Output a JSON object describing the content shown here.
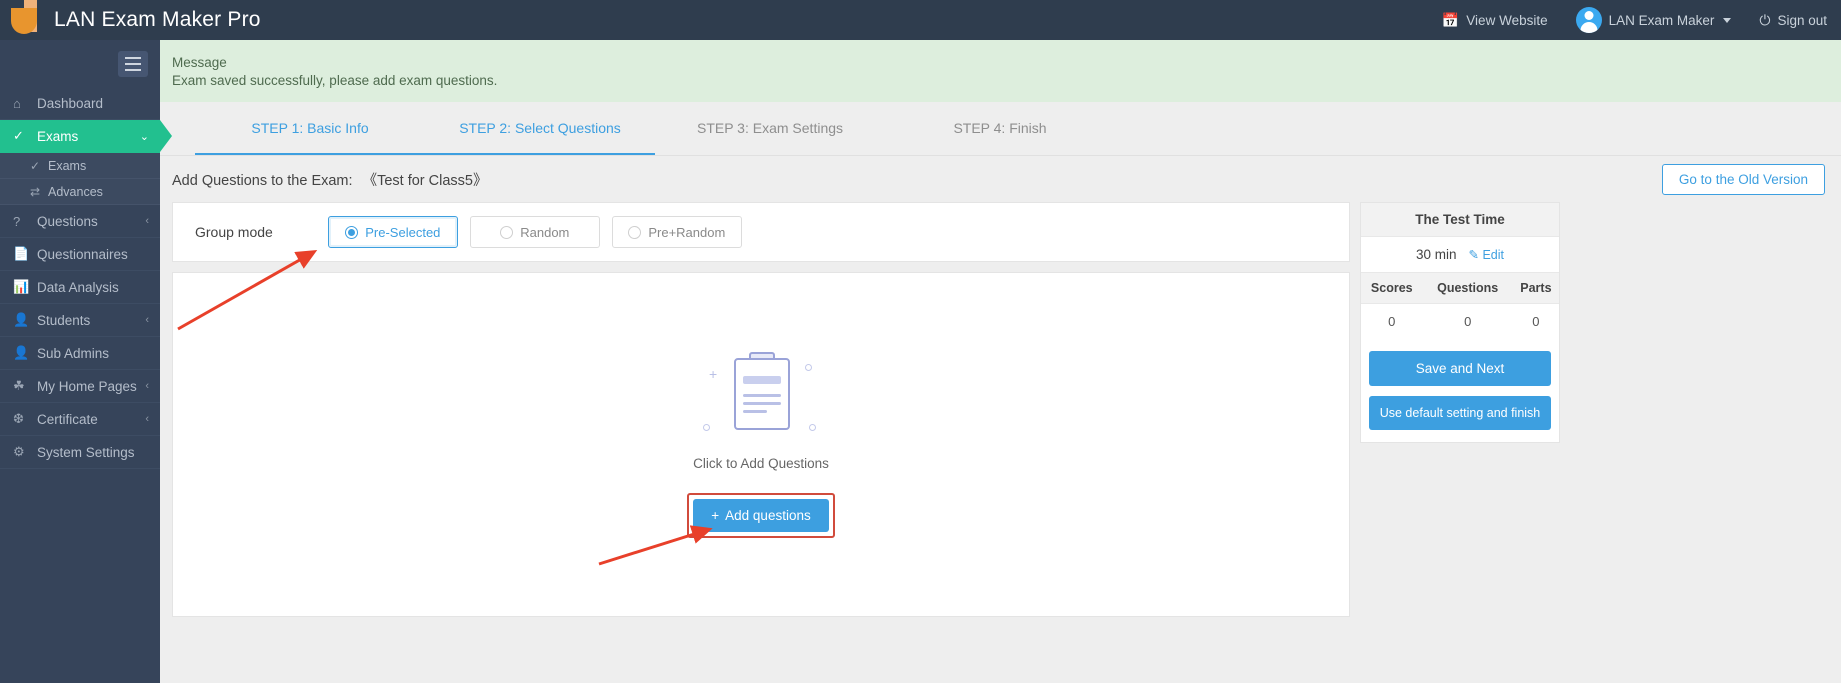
{
  "app": {
    "title": "LAN Exam Maker Pro",
    "logo_icon": "j-logo-icon"
  },
  "topbar": {
    "view_website": "View Website",
    "view_website_icon": "calendar-icon",
    "user_name": "LAN Exam Maker",
    "avatar_icon": "user-avatar-icon",
    "caret_icon": "chevron-down-icon",
    "sign_out": "Sign out",
    "sign_out_icon": "power-icon"
  },
  "sidebar": {
    "toggle_icon": "hamburger-icon",
    "items": [
      {
        "label": "Dashboard",
        "icon": "home-icon",
        "chevron": "",
        "active": false
      },
      {
        "label": "Exams",
        "icon": "check-circle-icon",
        "chevron": "⌄",
        "active": true
      },
      {
        "label": "Questions",
        "icon": "question-circle-icon",
        "chevron": "‹",
        "active": false
      },
      {
        "label": "Questionnaires",
        "icon": "documents-icon",
        "chevron": "",
        "active": false
      },
      {
        "label": "Data Analysis",
        "icon": "bar-chart-icon",
        "chevron": "",
        "active": false
      },
      {
        "label": "Students",
        "icon": "user-icon",
        "chevron": "‹",
        "active": false
      },
      {
        "label": "Sub Admins",
        "icon": "user-icon",
        "chevron": "",
        "active": false
      },
      {
        "label": "My Home Pages",
        "icon": "leaf-icon",
        "chevron": "‹",
        "active": false
      },
      {
        "label": "Certificate",
        "icon": "badge-icon",
        "chevron": "‹",
        "active": false
      },
      {
        "label": "System Settings",
        "icon": "gear-icon",
        "chevron": "",
        "active": false
      }
    ],
    "subitems": [
      {
        "label": "Exams",
        "icon": "check-circle-icon"
      },
      {
        "label": "Advances",
        "icon": "shuffle-icon"
      }
    ]
  },
  "alert": {
    "title": "Message",
    "text": "Exam saved successfully, please add exam questions.",
    "close_icon": "close-icon",
    "bg_color": "#ddeedd"
  },
  "steps": [
    {
      "label": "STEP 1: Basic Info",
      "state": "done"
    },
    {
      "label": "STEP 2: Select Questions",
      "state": "current"
    },
    {
      "label": "STEP 3: Exam Settings",
      "state": "pending"
    },
    {
      "label": "STEP 4: Finish",
      "state": "pending"
    }
  ],
  "subhead": {
    "title": "Add Questions to the Exam:",
    "exam_name": "《Test for Class5》",
    "old_version_button": "Go to the Old Version"
  },
  "group_mode": {
    "label": "Group mode",
    "options": [
      {
        "label": "Pre-Selected",
        "selected": true
      },
      {
        "label": "Random",
        "selected": false
      },
      {
        "label": "Pre+Random",
        "selected": false
      }
    ]
  },
  "empty_state": {
    "icon": "clipboard-add-icon",
    "text": "Click to Add Questions",
    "add_button": "Add questions",
    "add_button_icon": "plus-icon"
  },
  "right_panel": {
    "header": "The Test Time",
    "time_value": "30 min",
    "edit_label": "Edit",
    "edit_icon": "pencil-icon",
    "columns": [
      "Scores",
      "Questions",
      "Parts"
    ],
    "values": [
      "0",
      "0",
      "0"
    ],
    "save_next_button": "Save and Next",
    "default_finish_button": "Use default setting and finish"
  },
  "colors": {
    "accent_blue": "#3d9fe0",
    "sidebar_active_green": "#22c08f",
    "annotation_red": "#d14b3c",
    "topbar_dark": "#2f3d4e"
  }
}
